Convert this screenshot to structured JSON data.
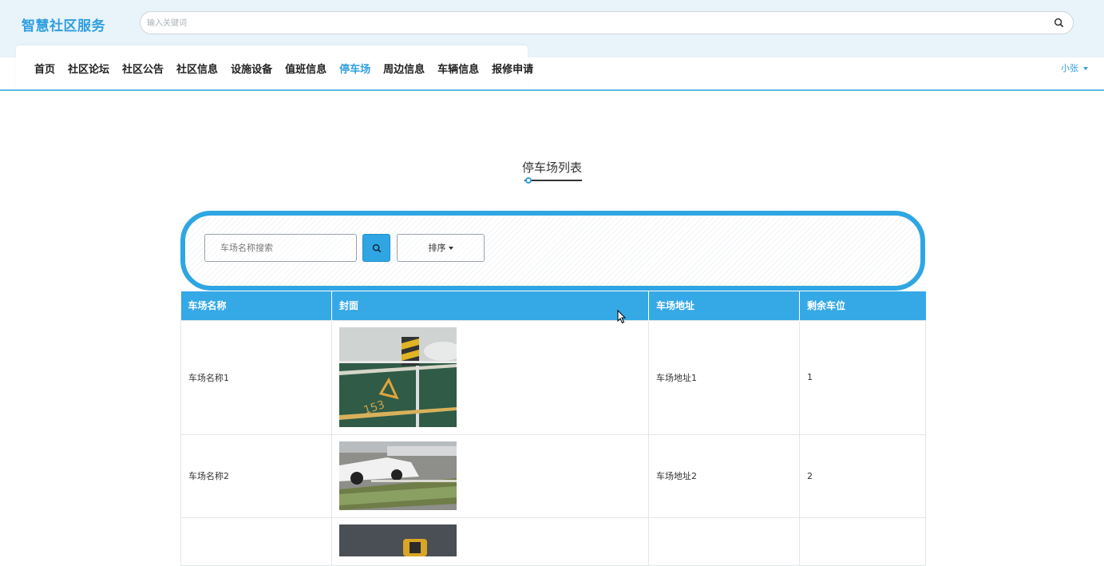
{
  "header": {
    "brand": "智慧社区服务",
    "search_placeholder": "输入关键词",
    "user": "小张"
  },
  "nav": {
    "items": [
      "首页",
      "社区论坛",
      "社区公告",
      "社区信息",
      "设施设备",
      "值班信息",
      "停车场",
      "周边信息",
      "车辆信息",
      "报修申请"
    ],
    "active": "停车场"
  },
  "page": {
    "title": "停车场列表"
  },
  "filter": {
    "name_placeholder": "车场名称搜索",
    "sort_label": "排序"
  },
  "table": {
    "headers": [
      "车场名称",
      "封面",
      "车场地址",
      "剩余车位"
    ],
    "rows": [
      {
        "name": "车场名称1",
        "address": "车场地址1",
        "spaces": "1"
      },
      {
        "name": "车场名称2",
        "address": "车场地址2",
        "spaces": "2"
      },
      {
        "name": "",
        "address": "",
        "spaces": ""
      }
    ]
  },
  "colors": {
    "accent": "#2fa6e3",
    "header_bg": "#e9f3fa",
    "table_header": "#35a9e6"
  }
}
